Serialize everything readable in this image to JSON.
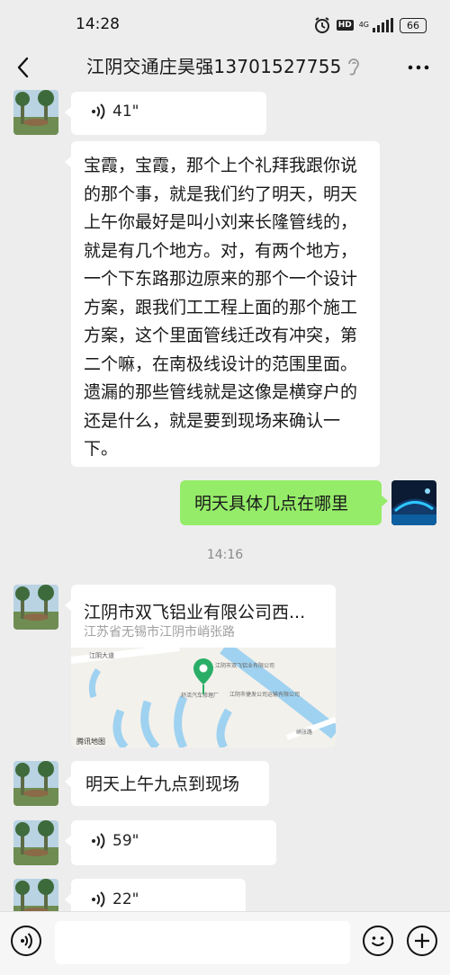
{
  "status": {
    "time": "14:28",
    "hd": "HD",
    "network": "4G",
    "battery": "66"
  },
  "header": {
    "title": "江阴交通庄昊强13701527755"
  },
  "messages": {
    "voice1": {
      "duration": "41\""
    },
    "text1": "宝霞，宝霞，那个上个礼拜我跟你说的那个事，就是我们约了明天，明天上午你最好是叫小刘来长隆管线的，就是有几个地方。对，有两个地方，一个下东路那边原来的那个一个设计方案，跟我们工工程上面的那个施工方案，这个里面管线迁改有冲突，第二个嘛，在南极线设计的范围里面。遗漏的那些管线就是这像是横穿户的还是什么，就是要到现场来确认一下。",
    "sent1": "明天具体几点在哪里",
    "timestamp": "14:16",
    "location": {
      "title": "江阴市双飞铝业有限公司西...",
      "address": "江苏省无锡市江阴市峭张路",
      "map_attribution": "腾讯地图",
      "map_labels": [
        "江阴大道",
        "江阴市双飞铝业有限公司",
        "舒活汽车修理厂",
        "江阴市捷发公司运输有限公司",
        "峭张路"
      ]
    },
    "text2": "明天上午九点到现场",
    "voice2": {
      "duration": "59\""
    },
    "voice3": {
      "duration": "22\""
    }
  }
}
